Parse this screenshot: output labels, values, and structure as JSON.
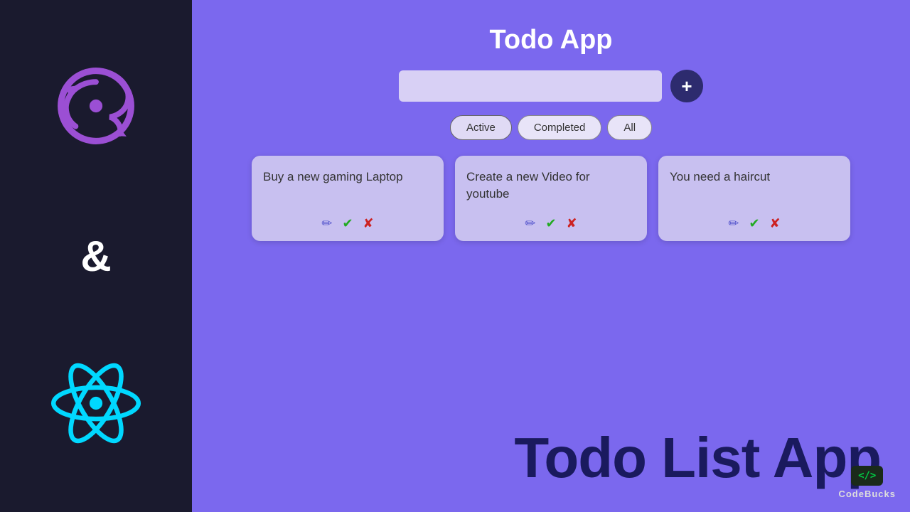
{
  "app": {
    "title": "Todo App",
    "big_title": "Todo List App"
  },
  "input": {
    "placeholder": "",
    "value": ""
  },
  "add_button": {
    "label": "+"
  },
  "filters": [
    {
      "id": "active",
      "label": "Active"
    },
    {
      "id": "completed",
      "label": "Completed"
    },
    {
      "id": "all",
      "label": "All"
    }
  ],
  "todos": [
    {
      "id": 1,
      "text": "Buy a new gaming Laptop"
    },
    {
      "id": 2,
      "text": "Create a new Video for youtube"
    },
    {
      "id": 3,
      "text": "You need a haircut"
    }
  ],
  "actions": {
    "edit": "✏",
    "check": "✔",
    "delete": "✘"
  },
  "branding": {
    "code_icon": "</>",
    "name": "CodeBucks"
  },
  "ampersand": "&"
}
